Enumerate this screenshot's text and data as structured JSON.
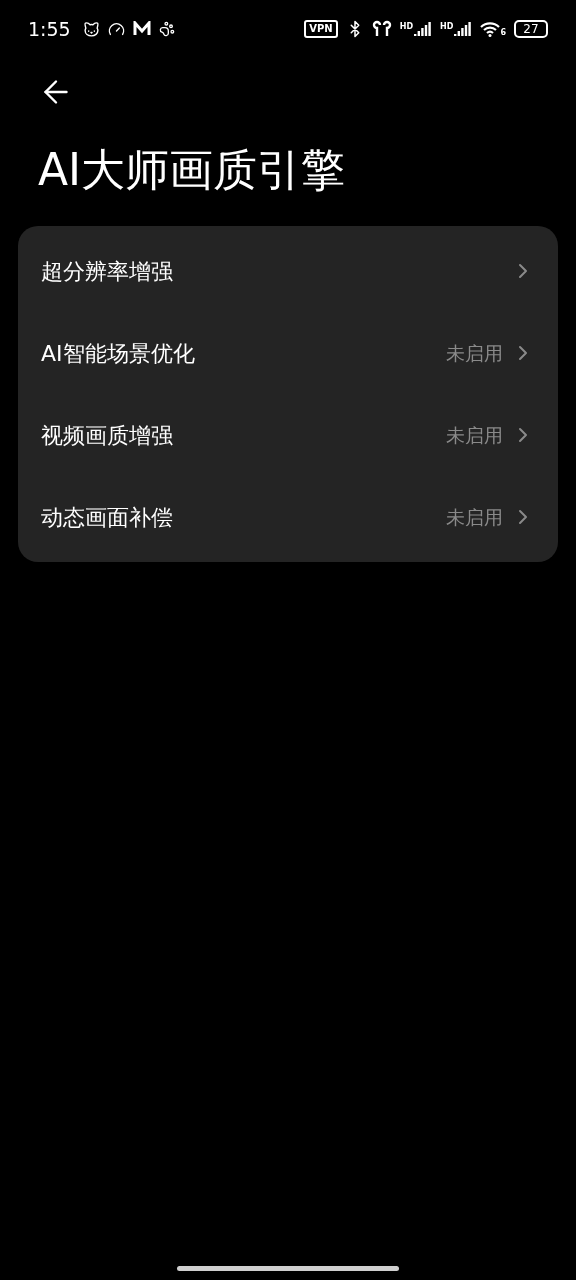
{
  "status_bar": {
    "time": "1:55",
    "vpn": "VPN",
    "signal_1": "HD",
    "signal_2": "HD",
    "wifi": "6",
    "battery": "27"
  },
  "title": "AI大师画质引擎",
  "items": [
    {
      "label": "超分辨率增强"
    },
    {
      "label": "AI智能场景优化",
      "value": "未启用"
    },
    {
      "label": "视频画质增强",
      "value": "未启用"
    },
    {
      "label": "动态画面补偿",
      "value": "未启用"
    }
  ]
}
